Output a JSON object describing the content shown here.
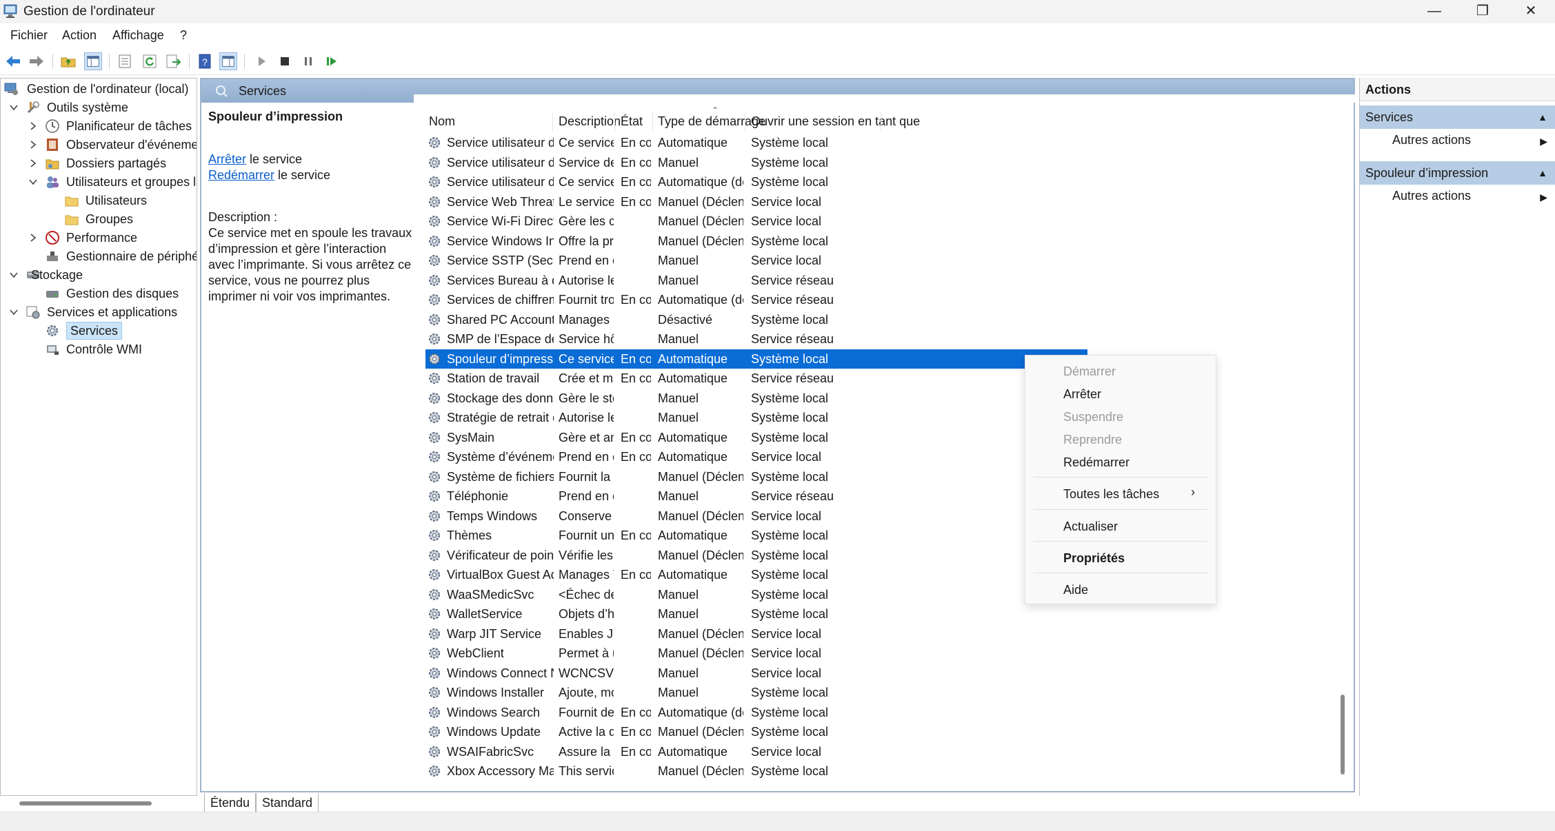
{
  "window": {
    "title": "Gestion de l'ordinateur",
    "minimize_glyph": "—",
    "restore_glyph": "❐",
    "close_glyph": "✕"
  },
  "menu": [
    "Fichier",
    "Action",
    "Affichage",
    "?"
  ],
  "tree": {
    "root": "Gestion de l'ordinateur (local)",
    "outils": "Outils système",
    "planificateur": "Planificateur de tâches",
    "observateur": "Observateur d'événeme",
    "dossiers": "Dossiers partagés",
    "utilisateurs_groupes": "Utilisateurs et groupes l",
    "utilisateurs": "Utilisateurs",
    "groupes": "Groupes",
    "performance": "Performance",
    "gestionnaire": "Gestionnaire de périphé",
    "stockage": "Stockage",
    "disques": "Gestion des disques",
    "services_apps": "Services et applications",
    "services": "Services",
    "wmi": "Contrôle WMI"
  },
  "center": {
    "header": "Services",
    "selected_service": "Spouleur d’impression",
    "stop_link": "Arrêter",
    "stop_suffix": " le service",
    "restart_link": "Redémarrer",
    "restart_suffix": " le service",
    "description_label": "Description :",
    "description_text": "Ce service met en spoule les travaux d’impression et gère l’interaction avec l’imprimante.  Si vous arrêtez ce service, vous ne pourrez plus imprimer ni voir vos imprimantes."
  },
  "columns": [
    "Nom",
    "Description",
    "État",
    "Type de démarrage",
    "Ouvrir une session en tant que"
  ],
  "rows": [
    [
      "Service utilisateur de notific...",
      "Ce service h...",
      "En co...",
      "Automatique",
      "Système local"
    ],
    [
      "Service utilisateur du kit de ...",
      "Service de c...",
      "En co...",
      "Manuel",
      "Système local"
    ],
    [
      "Service utilisateur du Presse-...",
      "Ce service ut...",
      "En co...",
      "Automatique (début ...",
      "Système local"
    ],
    [
      "Service Web Threat Defense",
      "Le service de...",
      "En co...",
      "Manuel (Déclencher l...",
      "Service local"
    ],
    [
      "Service Wi-Fi Direct Service ...",
      "Gère les con...",
      "",
      "Manuel (Déclencher l...",
      "Service local"
    ],
    [
      "Service Windows Insider",
      "Offre la pris...",
      "",
      "Manuel (Déclencher l...",
      "Système local"
    ],
    [
      "Service SSTP (Secure Socket ...",
      "Prend en ch...",
      "",
      "Manuel",
      "Service local"
    ],
    [
      "Services Bureau à distance",
      "Autorise les ...",
      "",
      "Manuel",
      "Service réseau"
    ],
    [
      "Services de chiffrement",
      "Fournit trois...",
      "En co...",
      "Automatique (déclen...",
      "Service réseau"
    ],
    [
      "Shared PC Account Manager",
      "Manages pr...",
      "",
      "Désactivé",
      "Système local"
    ],
    [
      "SMP de l’Espace de stockage...",
      "Service hôte ...",
      "",
      "Manuel",
      "Service réseau"
    ],
    [
      "Spouleur d’impression",
      "Ce service m...",
      "En co...",
      "Automatique",
      "Système local"
    ],
    [
      "Station de travail",
      "Crée et main...",
      "En co...",
      "Automatique",
      "Service réseau"
    ],
    [
      "Stockage des données utilis...",
      "Gère le stock...",
      "",
      "Manuel",
      "Système local"
    ],
    [
      "Stratégie de retrait de la cart...",
      "Autorise le s...",
      "",
      "Manuel",
      "Système local"
    ],
    [
      "SysMain",
      "Gère et amél...",
      "En co...",
      "Automatique",
      "Système local"
    ],
    [
      "Système d’événement COM+",
      "Prend en ch...",
      "En co...",
      "Automatique",
      "Service local"
    ],
    [
      "Système de fichiers EFS (Encr...",
      "Fournit la te...",
      "",
      "Manuel (Déclencher l...",
      "Système local"
    ],
    [
      "Téléphonie",
      "Prend en ch...",
      "",
      "Manuel",
      "Service réseau"
    ],
    [
      "Temps Windows",
      "Conserve la ...",
      "",
      "Manuel (Déclencher l...",
      "Service local"
    ],
    [
      "Thèmes",
      "Fournit un s...",
      "En co...",
      "Automatique",
      "Système local"
    ],
    [
      "Vérificateur de points",
      "Vérifie les en...",
      "",
      "Manuel (Déclencher l...",
      "Système local"
    ],
    [
      "VirtualBox Guest Additions S...",
      "Manages V...",
      "En co...",
      "Automatique",
      "Système local"
    ],
    [
      "WaaSMedicSvc",
      "<Échec de la...",
      "",
      "Manuel",
      "Système local"
    ],
    [
      "WalletService",
      "Objets d’hôt...",
      "",
      "Manuel",
      "Système local"
    ],
    [
      "Warp JIT Service",
      "Enables JIT c...",
      "",
      "Manuel (Déclencher l...",
      "Service local"
    ],
    [
      "WebClient",
      "Permet à un ...",
      "",
      "Manuel (Déclencher l...",
      "Service local"
    ],
    [
      "Windows Connect Now - Re...",
      "WCNCSVC h...",
      "",
      "Manuel",
      "Service local"
    ],
    [
      "Windows Installer",
      "Ajoute, modi...",
      "",
      "Manuel",
      "Système local"
    ],
    [
      "Windows Search",
      "Fournit des f...",
      "En co...",
      "Automatique (début ...",
      "Système local"
    ],
    [
      "Windows Update",
      "Active la dét...",
      "En co...",
      "Manuel (Déclencher l...",
      "Système local"
    ],
    [
      "WSAIFabricSvc",
      "Assure la pri...",
      "En co...",
      "Automatique",
      "Service local"
    ],
    [
      "Xbox Accessory Managemen...",
      "This service ...",
      "",
      "Manuel (Déclencher l...",
      "Système local"
    ]
  ],
  "selected_row_index": 11,
  "tabs": [
    "Étendu",
    "Standard"
  ],
  "actions": {
    "title": "Actions",
    "section1": "Services",
    "section1_item": "Autres actions",
    "section2": "Spouleur d’impression",
    "section2_item": "Autres actions"
  },
  "context_menu": {
    "start": "Démarrer",
    "stop": "Arrêter",
    "pause": "Suspendre",
    "resume": "Reprendre",
    "restart": "Redémarrer",
    "all_tasks": "Toutes les tâches",
    "refresh": "Actualiser",
    "properties": "Propriétés",
    "help": "Aide"
  },
  "colors": {
    "selection": "#0a6cd6",
    "header_band": "#a9c1dc",
    "action_section": "#b6cce4",
    "link": "#0a5ecf"
  }
}
